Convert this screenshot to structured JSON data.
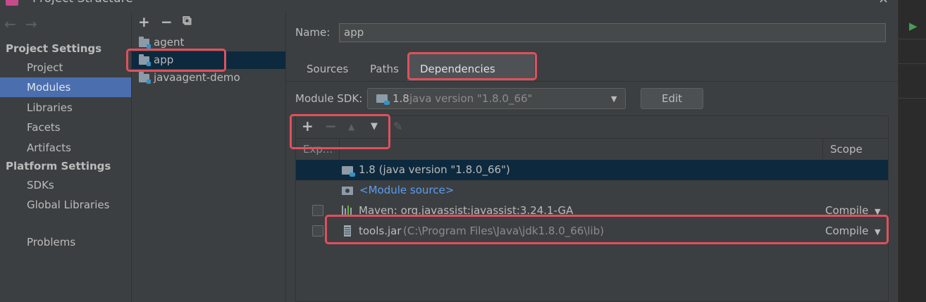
{
  "window": {
    "title": "Project Structure",
    "close_glyph": "×",
    "run_glyph": "▶"
  },
  "nav": {
    "back_glyph": "←",
    "forward_glyph": "→",
    "project_settings_heading": "Project Settings",
    "project_settings_items": [
      "Project",
      "Modules",
      "Libraries",
      "Facets",
      "Artifacts"
    ],
    "selected_item": "Modules",
    "platform_settings_heading": "Platform Settings",
    "platform_settings_items": [
      "SDKs",
      "Global Libraries"
    ],
    "problems_label": "Problems"
  },
  "modules": {
    "toolbar": {
      "add_glyph": "+",
      "remove_glyph": "−",
      "copy_glyph": "⧉"
    },
    "items": [
      "agent",
      "app",
      "javaagent-demo"
    ],
    "selected": "app"
  },
  "main": {
    "name_label": "Name:",
    "name_value": "app",
    "tabs": [
      "Sources",
      "Paths",
      "Dependencies"
    ],
    "active_tab": "Dependencies",
    "module_sdk_label": "Module SDK:",
    "sdk_version": "1.8",
    "sdk_detail": "java version \"1.8.0_66\"",
    "edit_button": "Edit",
    "dep_toolbar": {
      "add_glyph": "+",
      "remove_glyph": "−",
      "up_glyph": "▲",
      "down_glyph": "▼",
      "edit_glyph": "✎"
    },
    "columns": {
      "export": "Exp...",
      "scope": "Scope"
    },
    "dependencies": [
      {
        "name": "1.8 (java version \"1.8.0_66\")",
        "detail": "",
        "scope": "",
        "checkbox": false
      },
      {
        "name": "<Module source>",
        "detail": "",
        "scope": "",
        "checkbox": false
      },
      {
        "name": "Maven: org.javassist:javassist:3.24.1-GA",
        "detail": "",
        "scope": "Compile",
        "checkbox": true
      },
      {
        "name": "tools.jar",
        "detail": "(C:\\Program Files\\Java\\jdk1.8.0_66\\lib)",
        "scope": "Compile",
        "checkbox": true
      }
    ]
  },
  "colors": {
    "background": "#3c3f41",
    "selection_nav": "#4b6eaf",
    "selection_row": "#0d293e",
    "highlight_box": "#e0505d",
    "link": "#589df6"
  }
}
